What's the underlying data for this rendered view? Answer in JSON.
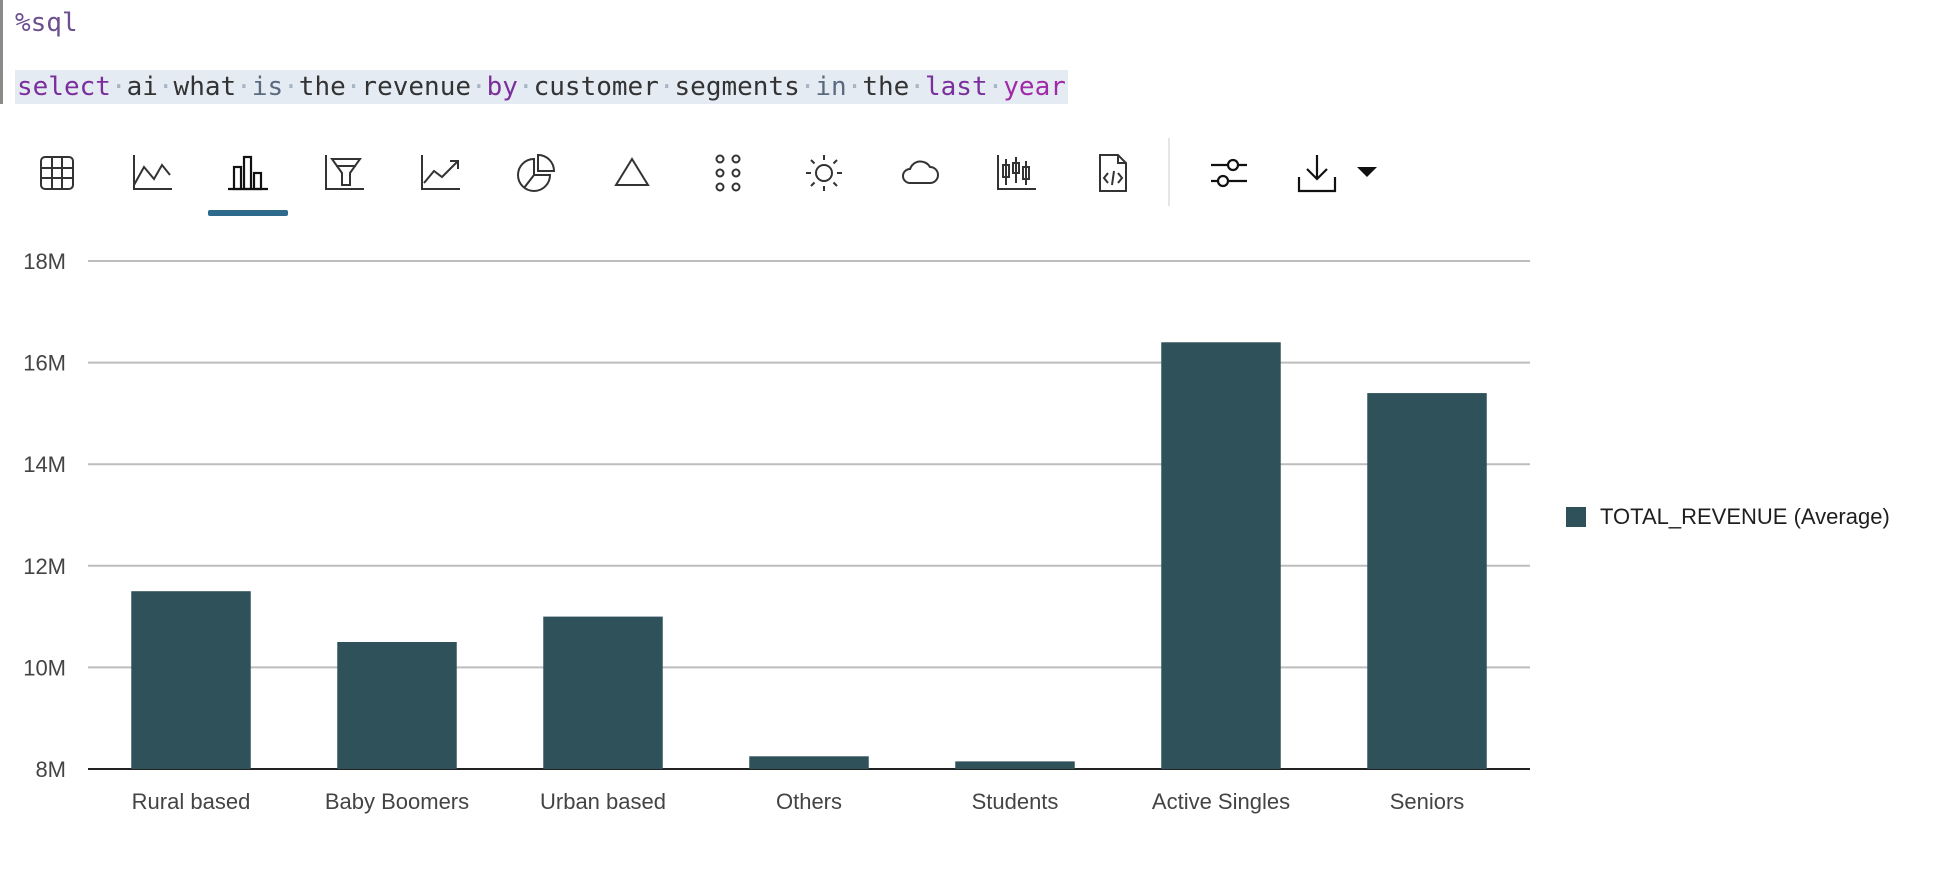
{
  "editor": {
    "line1": "%sql",
    "line2_tokens": [
      {
        "text": "select",
        "cls": "k-purple"
      },
      {
        "text": "ai",
        "cls": "k-plain"
      },
      {
        "text": "what",
        "cls": "k-plain"
      },
      {
        "text": "is",
        "cls": "k-grey"
      },
      {
        "text": "the",
        "cls": "k-plain"
      },
      {
        "text": "revenue",
        "cls": "k-plain"
      },
      {
        "text": "by",
        "cls": "k-purple"
      },
      {
        "text": "customer",
        "cls": "k-plain"
      },
      {
        "text": "segments",
        "cls": "k-plain"
      },
      {
        "text": "in",
        "cls": "k-grey"
      },
      {
        "text": "the",
        "cls": "k-plain"
      },
      {
        "text": "last",
        "cls": "k-purple"
      },
      {
        "text": "year",
        "cls": "k-magenta"
      }
    ]
  },
  "toolbar": {
    "icons": [
      "table-icon",
      "line-chart-icon",
      "bar-chart-icon",
      "funnel-chart-icon",
      "trend-line-icon",
      "pie-chart-icon",
      "triangle-icon",
      "scatter-dots-icon",
      "sun-icon",
      "cloud-icon",
      "candlestick-icon",
      "code-file-icon",
      "settings-sliders-icon",
      "download-icon",
      "dropdown-caret-icon"
    ],
    "active": "bar-chart-icon"
  },
  "chart_data": {
    "type": "bar",
    "categories": [
      "Rural based",
      "Baby Boomers",
      "Urban based",
      "Others",
      "Students",
      "Active Singles",
      "Seniors"
    ],
    "series": [
      {
        "name": "TOTAL_REVENUE (Average)",
        "values": [
          11500000,
          10500000,
          11000000,
          8250000,
          8150000,
          16400000,
          15400000
        ]
      }
    ],
    "yticks": [
      "8M",
      "10M",
      "12M",
      "14M",
      "16M",
      "18M"
    ],
    "ylim": [
      8000000,
      18000000
    ],
    "grid": true,
    "legend": "right",
    "bar_color": "#2f5159"
  }
}
